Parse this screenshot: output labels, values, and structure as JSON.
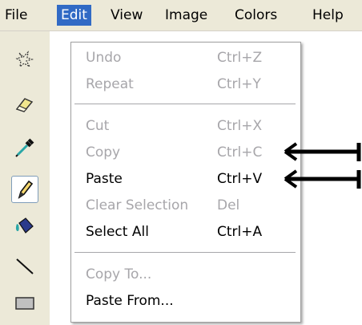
{
  "menubar": {
    "items": [
      {
        "label": "File"
      },
      {
        "label": "Edit"
      },
      {
        "label": "View"
      },
      {
        "label": "Image"
      },
      {
        "label": "Colors"
      },
      {
        "label": "Help"
      }
    ]
  },
  "edit_menu": {
    "undo": {
      "label": "Undo",
      "shortcut": "Ctrl+Z"
    },
    "repeat": {
      "label": "Repeat",
      "shortcut": "Ctrl+Y"
    },
    "cut": {
      "label": "Cut",
      "shortcut": "Ctrl+X"
    },
    "copy": {
      "label": "Copy",
      "shortcut": "Ctrl+C"
    },
    "paste": {
      "label": "Paste",
      "shortcut": "Ctrl+V"
    },
    "clear_selection": {
      "label": "Clear Selection",
      "shortcut": "Del"
    },
    "select_all": {
      "label": "Select All",
      "shortcut": "Ctrl+A"
    },
    "copy_to": {
      "label": "Copy To..."
    },
    "paste_from": {
      "label": "Paste From..."
    }
  },
  "colors": {
    "menu_highlight": "#316ac5",
    "disabled_text": "#a7a6aa",
    "chrome": "#ece9d8"
  },
  "toolbar": {
    "tools": [
      "free-form-select-icon",
      "eraser-icon",
      "color-picker-icon",
      "pencil-icon",
      "fill-icon",
      "line-icon",
      "rectangle-icon"
    ]
  }
}
